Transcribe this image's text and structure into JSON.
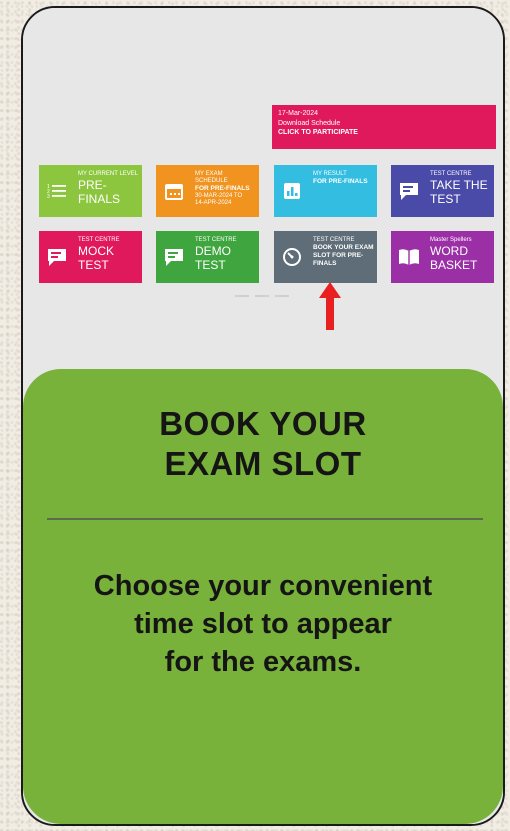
{
  "banner": {
    "date": "17-Mar-2024",
    "line2": "Download Schedule",
    "cta": "CLICK TO PARTICIPATE",
    "color": "#e0195c"
  },
  "tiles": [
    {
      "small": "MY CURRENT LEVEL",
      "big": "PRE-FINALS",
      "icon": "list-icon",
      "color": "#8cc63e"
    },
    {
      "small": "MY EXAM SCHEDULE",
      "mid": "FOR PRE-FINALS",
      "extra1": "30-Mar-2024 to",
      "extra2": "14-Apr-2024",
      "icon": "calendar-icon",
      "color": "#f0931f"
    },
    {
      "small": "MY RESULT",
      "mid": "FOR PRE-FINALS",
      "icon": "bar-chart-icon",
      "color": "#33bde0"
    },
    {
      "small": "TEST CENTRE",
      "big": "TAKE THE TEST",
      "icon": "chat-icon",
      "color": "#4a4aa8"
    },
    {
      "small": "TEST CENTRE",
      "big": "MOCK TEST",
      "icon": "chat-icon",
      "color": "#e0195c"
    },
    {
      "small": "TEST CENTRE",
      "big": "DEMO TEST",
      "icon": "chat-icon",
      "color": "#3fa53f"
    },
    {
      "small": "TEST CENTRE",
      "mid": "BOOK YOUR EXAM SLOT FOR PRE-FINALS",
      "icon": "timer-icon",
      "color": "#5e6d77"
    },
    {
      "small": "Master Spellers",
      "big": "WORD BASKET",
      "icon": "book-icon",
      "color": "#9b2fa5"
    }
  ],
  "card": {
    "title_line1": "BOOK YOUR",
    "title_line2": "EXAM SLOT",
    "desc_line1": "Choose your convenient",
    "desc_line2": "time slot to appear",
    "desc_line3": "for the exams."
  }
}
